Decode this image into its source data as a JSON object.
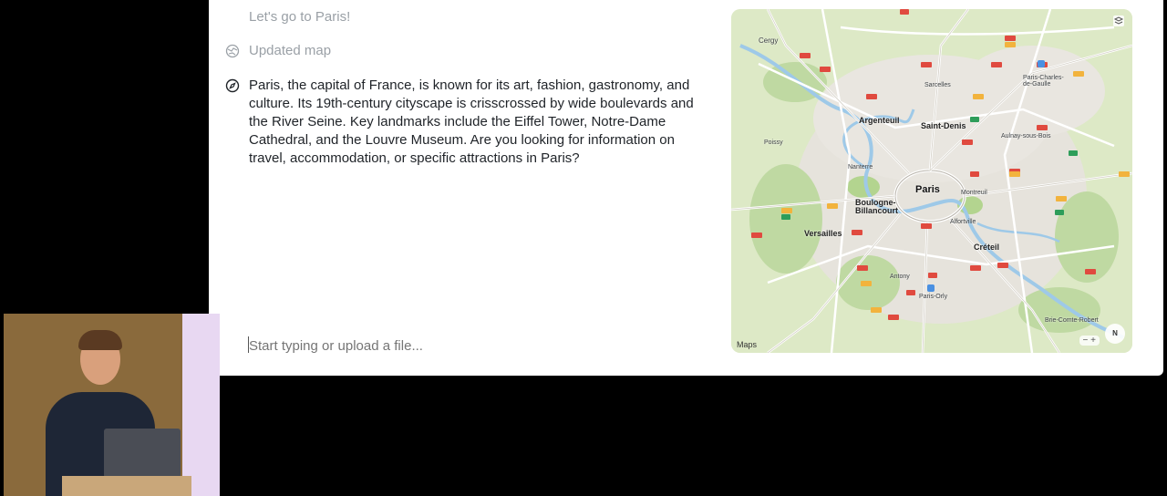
{
  "chat": {
    "user_message": "Let's go to Paris!",
    "tool_status": "Updated map",
    "assistant_message": "Paris, the capital of France, is known for its art, fashion, gastronomy, and culture. Its 19th-century cityscape is crisscrossed by wide boulevards and the River Seine. Key landmarks include the Eiffel Tower, Notre-Dame Cathedral, and the Louvre Museum. Are you looking for information on travel, accommodation, or specific attractions in Paris?",
    "composer_placeholder": "Start typing or upload a file..."
  },
  "map": {
    "brand": "Maps",
    "compass": "N",
    "zoom_controls": "− +",
    "labels": {
      "paris": "Paris",
      "saint_denis": "Saint-Denis",
      "argenteuil": "Argenteuil",
      "boulogne": "Boulogne-Billancourt",
      "versailles": "Versailles",
      "creteil": "Créteil",
      "montreuil": "Montreuil",
      "cergy": "Cergy",
      "nanterre": "Nanterre",
      "antony": "Antony",
      "sarcelles": "Sarcelles",
      "aulnay": "Aulnay-sous-Bois",
      "poissy": "Poissy",
      "alfortville": "Alfortville",
      "brie": "Brie-Comte-Robert",
      "cdg": "Paris-Charles-de-Gaulle",
      "orly": "Paris-Orly"
    },
    "colors": {
      "land": "#dde9c6",
      "urban": "#e6e3dc",
      "road": "#ffffff",
      "route_badge": "#e04a3f"
    }
  },
  "presenter": {
    "description_icon": "presenter-video"
  }
}
